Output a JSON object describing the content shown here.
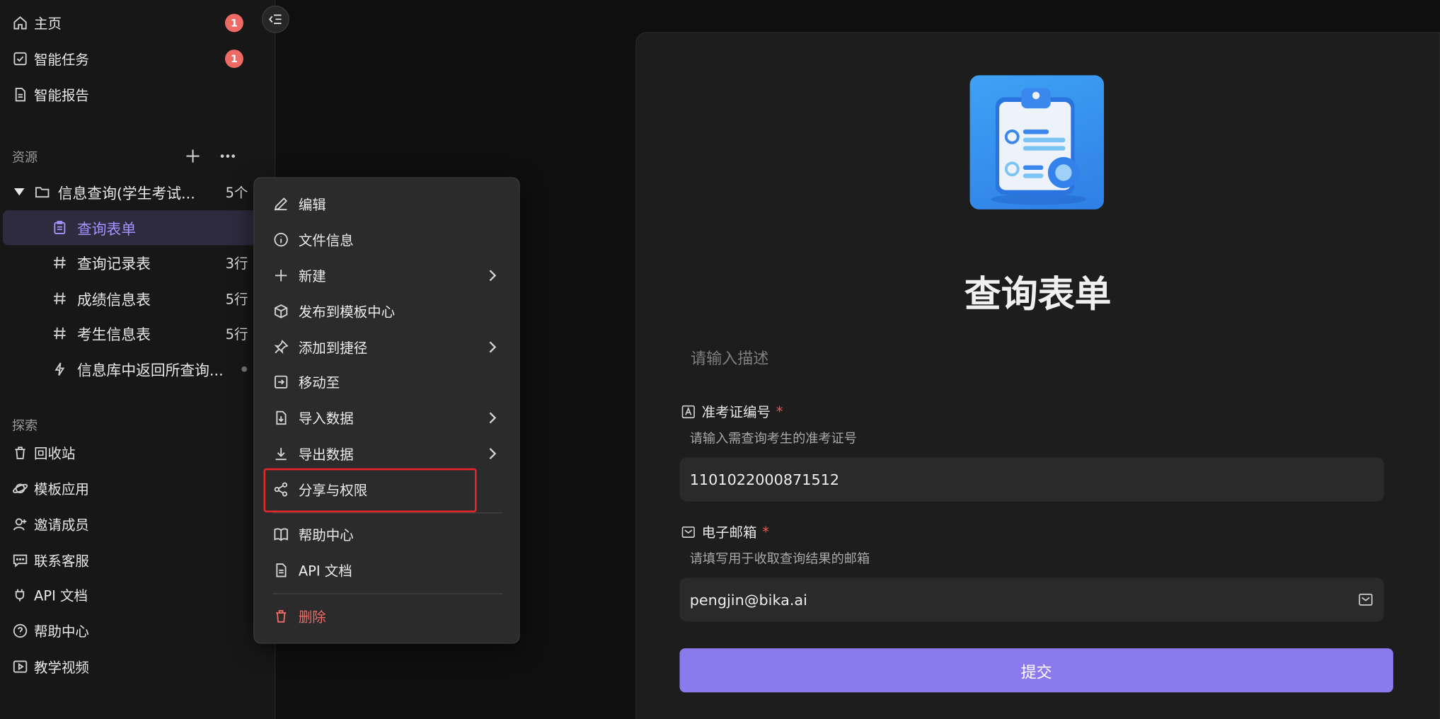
{
  "sidebar": {
    "nav": [
      {
        "label": "主页",
        "badge": "1",
        "icon": "home-icon"
      },
      {
        "label": "智能任务",
        "badge": "1",
        "icon": "task-checkbox-icon"
      },
      {
        "label": "智能报告",
        "icon": "report-document-icon"
      }
    ],
    "resources_label": "资源",
    "folder": {
      "label": "信息查询(学生考试...",
      "count": "5个",
      "icon": "folder-icon"
    },
    "items": [
      {
        "label": "查询表单",
        "count": "",
        "icon": "form-icon"
      },
      {
        "label": "查询记录表",
        "count": "3行",
        "icon": "hash-table-icon"
      },
      {
        "label": "成绩信息表",
        "count": "5行",
        "icon": "hash-table-icon"
      },
      {
        "label": "考生信息表",
        "count": "5行",
        "icon": "hash-table-icon"
      },
      {
        "label": "信息库中返回所查询...",
        "count": "",
        "icon": "automation-bolt-icon"
      }
    ],
    "explore_label": "探索",
    "explore": [
      {
        "label": "回收站",
        "icon": "trash-icon"
      },
      {
        "label": "模板应用",
        "icon": "planet-icon"
      },
      {
        "label": "邀请成员",
        "icon": "invite-user-icon"
      },
      {
        "label": "联系客服",
        "icon": "chat-support-icon"
      },
      {
        "label": "API 文档",
        "icon": "api-plug-icon"
      },
      {
        "label": "帮助中心",
        "icon": "help-circle-icon"
      },
      {
        "label": "教学视频",
        "icon": "video-play-icon"
      }
    ]
  },
  "context_menu": {
    "items": [
      {
        "label": "编辑",
        "icon": "edit-pencil-icon"
      },
      {
        "label": "文件信息",
        "icon": "info-icon"
      },
      {
        "label": "新建",
        "icon": "plus-icon"
      },
      {
        "label": "发布到模板中心",
        "icon": "publish-box-icon"
      },
      {
        "label": "添加到捷径",
        "icon": "pin-icon"
      },
      {
        "label": "移动至",
        "icon": "move-icon"
      },
      {
        "label": "导入数据",
        "icon": "import-icon"
      },
      {
        "label": "导出数据",
        "icon": "download-icon"
      },
      {
        "label": "分享与权限",
        "icon": "share-icon"
      },
      {
        "label": "帮助中心",
        "icon": "book-icon"
      },
      {
        "label": "API 文档",
        "icon": "api-doc-icon"
      },
      {
        "label": "删除",
        "icon": "delete-icon"
      }
    ]
  },
  "form": {
    "title": "查询表单",
    "description_placeholder": "请输入描述",
    "fields": [
      {
        "label": "准考证编号",
        "required": "*",
        "hint": "请输入需查询考生的准考证号",
        "value": "1101022000871512",
        "icon": "text-field-icon"
      },
      {
        "label": "电子邮箱",
        "required": "*",
        "hint": "请填写用于收取查询结果的邮箱",
        "value": "pengjin@bika.ai",
        "icon": "email-icon"
      }
    ],
    "submit_label": "提交"
  },
  "colors": {
    "accent": "#8b79ee",
    "badge": "#ee6a64",
    "danger": "#ee6a64",
    "highlight": "#e8262a",
    "selected_bg": "#2d2b3d"
  }
}
